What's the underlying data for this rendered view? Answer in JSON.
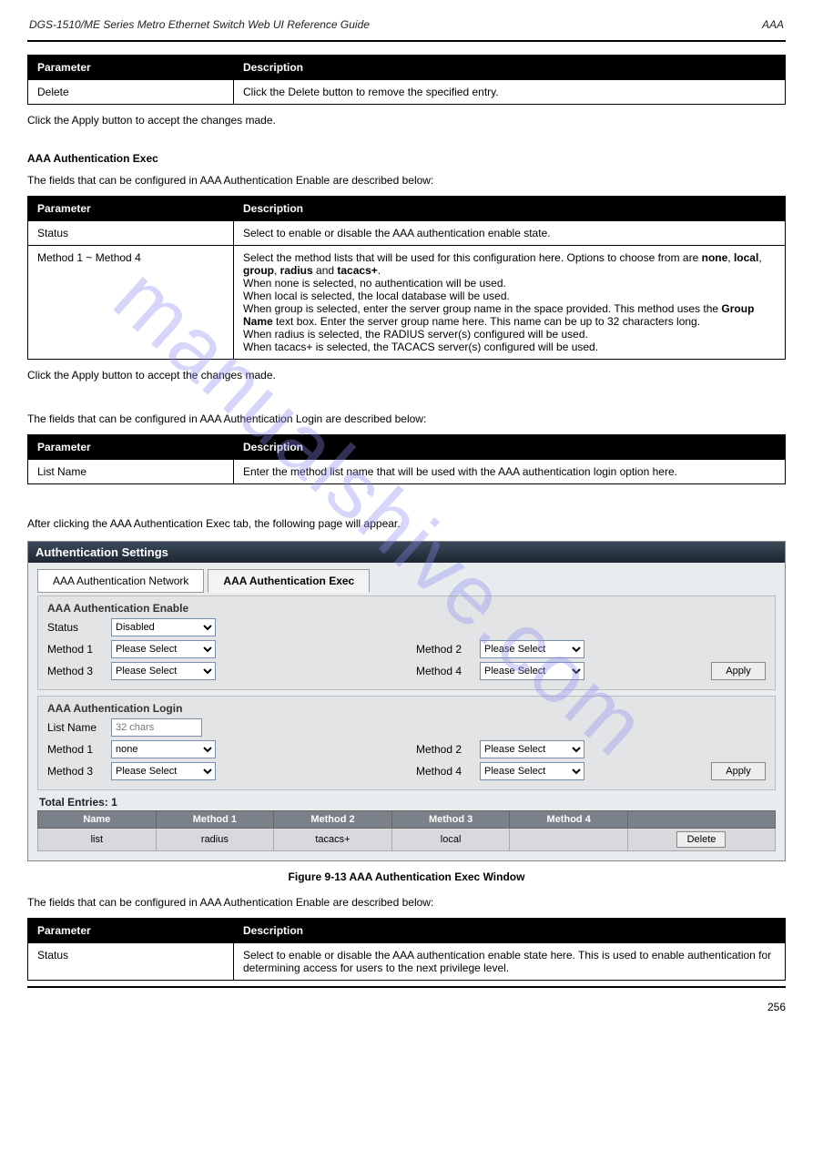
{
  "header": {
    "left": "DGS-1510/ME Series Metro Ethernet Switch Web UI Reference Guide",
    "right": "AAA"
  },
  "watermark": "manualshive.com",
  "table1": {
    "h1": "Parameter",
    "h2": "Description",
    "r1c1": "Delete",
    "r1c2": "Click the Delete button to remove the specified entry."
  },
  "afterTable1": "Click the Apply button to accept the changes made.",
  "section2_title": "AAA Authentication Exec",
  "section2_lead": "The fields that can be configured in AAA Authentication Enable are described below:",
  "table2": {
    "h1": "Parameter",
    "h2": "Description",
    "r1c1": "Status",
    "r1c2": "Select to enable or disable the AAA authentication enable state.",
    "r2c1": "Method 1 ~ Method 4",
    "r2c2a": "Select the method lists that will be used for this configuration here. Options to choose from are ",
    "r2c2b": "none",
    "r2c2c": ", ",
    "r2c2d": "local",
    "r2c2e": ", ",
    "r2c2f": "group",
    "r2c2g": ", ",
    "r2c2h": "radius",
    "r2c2i": " and ",
    "r2c2j": "tacacs+",
    "r2c2k": ".",
    "r2c2_none": "When none is selected, no authentication will be used.",
    "r2c2_local": "When local is selected, the local database will be used.",
    "r2c2_group_a": "When group is selected, enter the server group name in the space provided. This method uses the ",
    "r2c2_group_b": "Group Name",
    "r2c2_group_c": " text box. Enter the server group name here. This name can be up to 32 characters long.",
    "r2c2_radius": "When radius is selected, the RADIUS server(s) configured will be used.",
    "r2c2_tacacs": "When tacacs+ is selected, the TACACS server(s) configured will be used."
  },
  "afterTable2": "Click the Apply button to accept the changes made.",
  "section3_lead": "The fields that can be configured in AAA Authentication Login are described below:",
  "table3": {
    "h1": "Parameter",
    "h2": "Description",
    "r1c1": "List Name",
    "r1c2": "Enter the method list name that will be used with the AAA authentication login option here."
  },
  "afterTable3": "After clicking the AAA Authentication Exec tab, the following page will appear.",
  "screenshot": {
    "title": "Authentication Settings",
    "tab1": "AAA Authentication Network",
    "tab2": "AAA Authentication Exec",
    "enable_section": "AAA Authentication Enable",
    "login_section": "AAA Authentication Login",
    "status_label": "Status",
    "status_value": "Disabled",
    "method1_label": "Method 1",
    "method2_label": "Method 2",
    "method3_label": "Method 3",
    "method4_label": "Method 4",
    "please_select": "Please Select",
    "listname_label": "List Name",
    "listname_placeholder": "32 chars",
    "method1_login_value": "none",
    "apply": "Apply",
    "total_entries": "Total Entries: 1",
    "th": {
      "name": "Name",
      "m1": "Method 1",
      "m2": "Method 2",
      "m3": "Method 3",
      "m4": "Method 4",
      "blank": ""
    },
    "row": {
      "name": "list",
      "m1": "radius",
      "m2": "tacacs+",
      "m3": "local",
      "m4": "",
      "del": "Delete"
    }
  },
  "figcaption": "Figure 9-13 AAA Authentication Exec Window",
  "section4_lead": "The fields that can be configured in AAA Authentication Enable are described below:",
  "table4": {
    "h1": "Parameter",
    "h2": "Description",
    "r1c1": "Status",
    "r1c2": "Select to enable or disable the AAA authentication enable state here. This is used to enable authentication for determining access for users to the next privilege level."
  },
  "pagenum": "256"
}
